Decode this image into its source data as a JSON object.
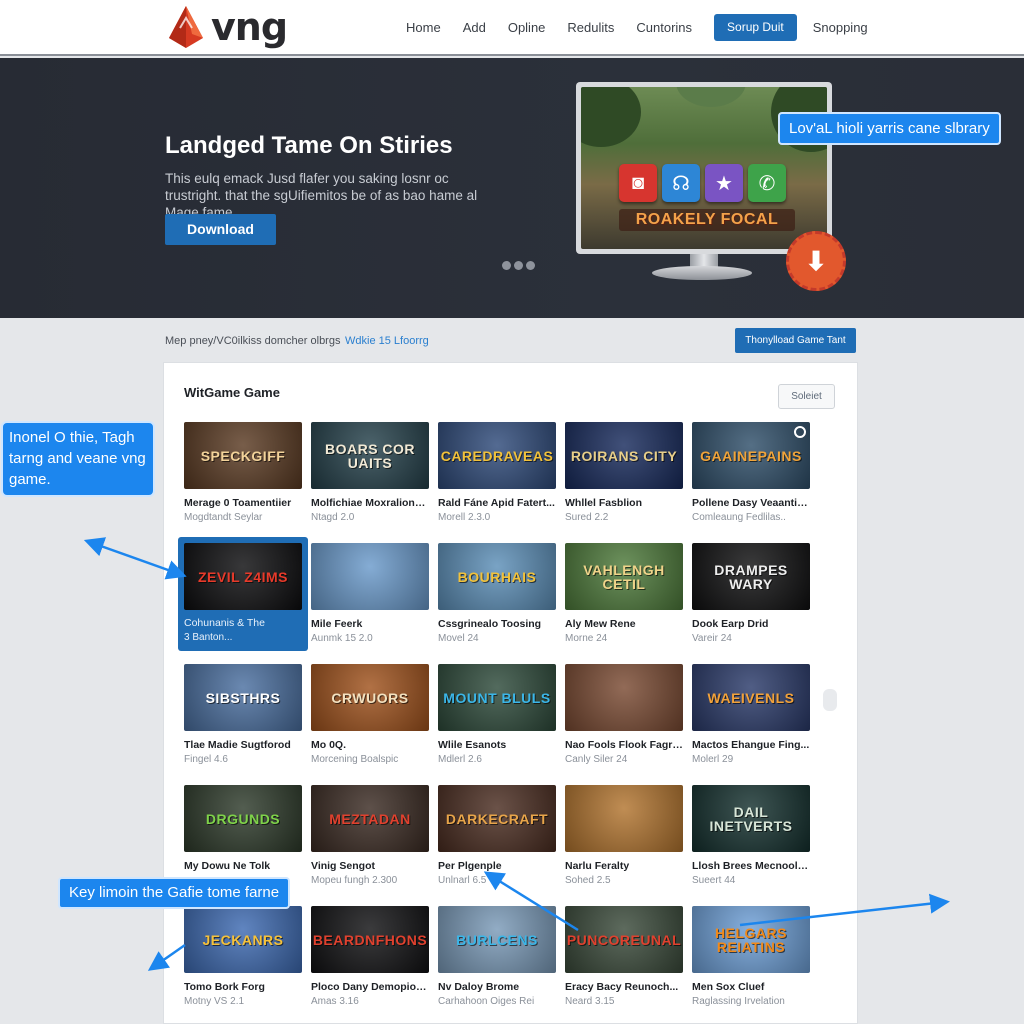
{
  "brand": {
    "name": "vng",
    "logo_icon": "red-crystal-logo-icon",
    "color": "#d63a22"
  },
  "nav": {
    "items": [
      "Home",
      "Add",
      "Opline",
      "Redulits",
      "Cuntorins"
    ],
    "cta_label": "Sorup Duit",
    "trailing_item": "Snopping"
  },
  "hero": {
    "title": "Landged Tame On Stiries",
    "description": "This eulq emack Jusd flafer you saking losnr oc trustright. that the sgUifiemitos be of as bao hame al Mage fame.",
    "download_label": "Download",
    "carousel_dots": 3,
    "screen_title": "ROAKELY FOCAL",
    "app_icons": [
      {
        "icon": "camera-icon",
        "glyph": "◙",
        "color": "#d7352f"
      },
      {
        "icon": "headset-icon",
        "glyph": "☊",
        "color": "#2d86d6"
      },
      {
        "icon": "star-icon",
        "glyph": "★",
        "color": "#7a54c3"
      },
      {
        "icon": "phone-icon",
        "glyph": "✆",
        "color": "#3ea34a"
      }
    ],
    "download_badge_icon": "download-arrow-icon",
    "callout": "Lov'aL hioli yarris cane slbrary"
  },
  "subbar": {
    "text": "Mep pney/VC0ilkiss domcher olbrgs",
    "link": "Wdkie 15 Lfoorrg",
    "button_label": "Thonylload Game Tant"
  },
  "panel": {
    "title": "WitGame Game",
    "select_label": "Soleiet",
    "games": [
      {
        "title": "Merage 0 Toamentiier",
        "sub": "Mogdtandt Seylar",
        "thumb": "SPECKGIFF",
        "bg": "#5a3a22",
        "fg": "#f3d39a"
      },
      {
        "title": "Molfichiae Moxralions...",
        "sub": "Ntagd 2.0",
        "thumb": "BOARS COR UAITS",
        "bg": "#24404a",
        "fg": "#f2ead6"
      },
      {
        "title": "Rald Fáne Apid Fatert...",
        "sub": "Morell 2.3.0",
        "thumb": "CAREDRAVEAS",
        "bg": "#2e4a7a",
        "fg": "#f2c23b"
      },
      {
        "title": "Whllel Fasblion",
        "sub": "Sured 2.2",
        "thumb": "ROIRANS CITY",
        "bg": "#172a5c",
        "fg": "#e8cf8a"
      },
      {
        "title": "Pollene Dasy Veaantis...",
        "sub": "Comleaung Fedlilas..",
        "thumb": "GAAINEPAINS",
        "bg": "#2f4f6a",
        "fg": "#f0a43a",
        "info": true
      },
      {
        "title": "Cohunanis & The",
        "sub": "3 Banton...",
        "thumb": "ZEVIL Z4IMS",
        "bg": "#0c0c0e",
        "fg": "#e83a2a",
        "selected": true
      },
      {
        "title": "Mile Feerk",
        "sub": "Aunmk 15 2.0",
        "thumb": "",
        "bg": "#6a9acb",
        "fg": "#ffffff"
      },
      {
        "title": "Cssgrinealo Toosing",
        "sub": "Movel 24",
        "thumb": "BOURHAIS",
        "bg": "#5c8fb8",
        "fg": "#f2c23b"
      },
      {
        "title": "Aly Mew Rene",
        "sub": "Morne 24",
        "thumb": "VAHLENGH CETIL",
        "bg": "#4d7a3a",
        "fg": "#f0d48a"
      },
      {
        "title": "Dook Earp Drid",
        "sub": "Vareir 24",
        "thumb": "DRAMPES WARY",
        "bg": "#0f0f10",
        "fg": "#eeeeee"
      },
      {
        "title": "Tlae Madie Sugtforod",
        "sub": "Fingel 4.6",
        "thumb": "SIBSTHRS",
        "bg": "#4a6fa0",
        "fg": "#ffffff"
      },
      {
        "title": "Mo 0Q.",
        "sub": "Morcening Boalspic",
        "thumb": "CRWUORS",
        "bg": "#a0521c",
        "fg": "#f4e2c0"
      },
      {
        "title": "Wlile Esanots",
        "sub": "Mdlerl 2.6",
        "thumb": "MOUNT BLULS",
        "bg": "#2d4a3a",
        "fg": "#3bb6e8"
      },
      {
        "title": "Nao Fools Flook Fagroc...",
        "sub": "Canly Siler 24",
        "thumb": "",
        "bg": "#7a4a32",
        "fg": "#ffffff"
      },
      {
        "title": "Mactos Ehangue Fing...",
        "sub": "Molerl 29",
        "thumb": "WAEIVENLS",
        "bg": "#2a3a6a",
        "fg": "#f2a23a"
      },
      {
        "title": "My Dowu Ne Tolk",
        "sub": "",
        "thumb": "DRGUNDS",
        "bg": "#2d3a2a",
        "fg": "#7fd34a"
      },
      {
        "title": "Vinig Sengot",
        "sub": "Mopeu fungh 2.300",
        "thumb": "MEZTADAN",
        "bg": "#3a2a22",
        "fg": "#e0412e"
      },
      {
        "title": "Per Plgenple",
        "sub": "Unlnarl 6.5",
        "thumb": "DARKECRAFT",
        "bg": "#4a2c20",
        "fg": "#e8a54a"
      },
      {
        "title": "Narlu Feralty",
        "sub": "Sohed 2.5",
        "thumb": "",
        "bg": "#b2742e",
        "fg": "#ffffff"
      },
      {
        "title": "Llosh Brees Mecnooling",
        "sub": "Sueert 44",
        "thumb": "DAIL INETVERTS",
        "bg": "#14302e",
        "fg": "#d8e6d8"
      },
      {
        "title": "Tomo Bork Forg",
        "sub": "Motny VS 2.1",
        "thumb": "JECKANRS",
        "bg": "#3d6ab2",
        "fg": "#f6c23a"
      },
      {
        "title": "Ploco Dany Demopion...",
        "sub": "Amas 3.16",
        "thumb": "BEARDNFHONS",
        "bg": "#101012",
        "fg": "#e0412e"
      },
      {
        "title": "Nv Daloy Brome",
        "sub": "Carhahoon Oiges Rei",
        "thumb": "BURLCENS",
        "bg": "#7a9ab8",
        "fg": "#3bb6e8"
      },
      {
        "title": "Eracy Bacy Reunoch...",
        "sub": "Neard 3.15",
        "thumb": "PUNCOREUNAL",
        "bg": "#3a4a3a",
        "fg": "#e0412e"
      },
      {
        "title": "Men Sox Cluef",
        "sub": "Raglassing Irvelation",
        "thumb": "HELGARS REIATINS",
        "bg": "#6ea0d8",
        "fg": "#f28a1a"
      }
    ]
  },
  "annotations": {
    "left_callout": "Inonel O thie, Tagh tarng and veane vng game.",
    "bottom_callout": "Key limoin the Gafie tome farne"
  },
  "colors": {
    "accent": "#1f6db5",
    "callout": "#1c86ee",
    "hero_bg": "#272b34"
  }
}
